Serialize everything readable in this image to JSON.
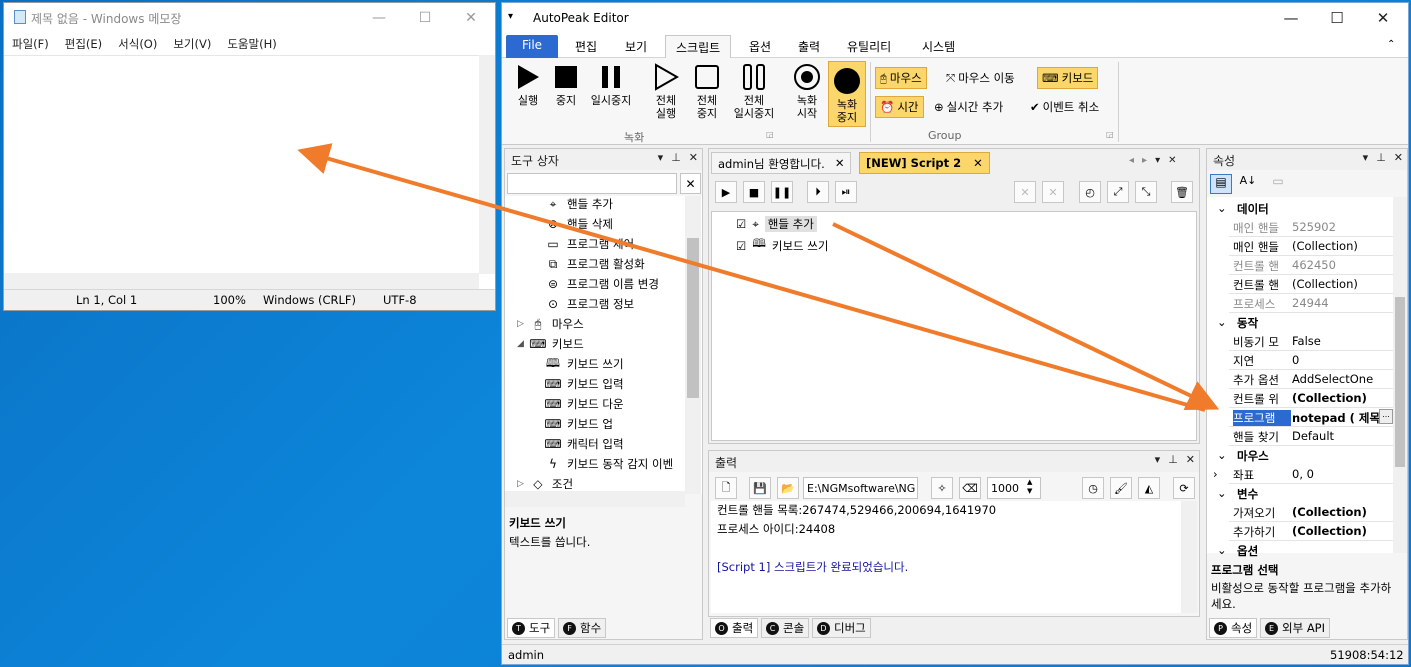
{
  "notepad": {
    "title": "제목 없음 - Windows 메모장",
    "menu": [
      "파일(F)",
      "편집(E)",
      "서식(O)",
      "보기(V)",
      "도움말(H)"
    ],
    "status": {
      "position": "Ln 1, Col 1",
      "zoom": "100%",
      "line_ending": "Windows (CRLF)",
      "encoding": "UTF-8"
    }
  },
  "app": {
    "title": "AutoPeak Editor",
    "ribbon_tabs": [
      "File",
      "편집",
      "보기",
      "스크립트",
      "옵션",
      "출력",
      "유틸리티",
      "시스템"
    ],
    "active_tab": "스크립트",
    "record_group": {
      "label": "녹화",
      "buttons": [
        {
          "label": "실행",
          "icon": "play-icon"
        },
        {
          "label": "중지",
          "icon": "stop-icon"
        },
        {
          "label": "일시중지",
          "icon": "pause-icon"
        },
        {
          "label": "전체\n실행",
          "icon": "play-outline-icon"
        },
        {
          "label": "전체\n중지",
          "icon": "stop-outline-icon"
        },
        {
          "label": "전체\n일시중지",
          "icon": "pause-outline-icon"
        },
        {
          "label": "녹화\n시작",
          "icon": "record-start-icon"
        },
        {
          "label": "녹화\n중지",
          "icon": "record-stop-icon"
        }
      ]
    },
    "group": {
      "label": "Group",
      "buttons": [
        "마우스",
        "마우스 이동",
        "키보드",
        "시간",
        "실시간 추가",
        "이벤트 취소"
      ]
    },
    "toolbox": {
      "title": "도구 상자",
      "items": [
        {
          "label": "핸들 추가",
          "indent": 2
        },
        {
          "label": "핸들 삭제",
          "indent": 2
        },
        {
          "label": "프로그램 제어",
          "indent": 2
        },
        {
          "label": "프로그램 활성화",
          "indent": 2
        },
        {
          "label": "프로그램 이름 변경",
          "indent": 2
        },
        {
          "label": "프로그램 정보",
          "indent": 2
        },
        {
          "label": "마우스",
          "indent": 1
        },
        {
          "label": "키보드",
          "indent": 1
        },
        {
          "label": "키보드 쓰기",
          "indent": 2
        },
        {
          "label": "키보드 입력",
          "indent": 2
        },
        {
          "label": "키보드 다운",
          "indent": 2
        },
        {
          "label": "키보드 업",
          "indent": 2
        },
        {
          "label": "캐릭터 입력",
          "indent": 2
        },
        {
          "label": "키보드 동작 감지 이벤",
          "indent": 2
        },
        {
          "label": "조건",
          "indent": 1
        }
      ],
      "desc_title": "키보드 쓰기",
      "desc_text": "텍스트를 씁니다.",
      "tabs": [
        "도구",
        "함수"
      ]
    },
    "script": {
      "tabs": [
        "admin님 환영합니다.",
        "[NEW] Script 2"
      ],
      "steps": [
        "핸들 추가",
        "키보드 쓰기"
      ]
    },
    "output": {
      "title": "출력",
      "path": "E:\\NGMsoftware\\NG",
      "count": "1000",
      "lines": [
        "컨트롤 핸들 목록:267474,529466,200694,1641970",
        "프로세스 아이디:24408",
        "",
        "[Script 1] 스크립트가 완료되었습니다."
      ],
      "tabs": [
        "출력",
        "콘솔",
        "디버그"
      ]
    },
    "properties": {
      "title": "속성",
      "categories": [
        {
          "name": "데이터",
          "rows": [
            {
              "k": "매인 핸들",
              "v": "525902",
              "gray": true
            },
            {
              "k": "매인 핸들",
              "v": "(Collection)",
              "gray": false
            },
            {
              "k": "컨트롤 핸",
              "v": "462450",
              "gray": true
            },
            {
              "k": "컨트롤 핸",
              "v": "(Collection)",
              "gray": false
            },
            {
              "k": "프로세스",
              "v": "24944",
              "gray": true
            }
          ]
        },
        {
          "name": "동작",
          "rows": [
            {
              "k": "비동기 모",
              "v": "False",
              "gray": false
            },
            {
              "k": "지연",
              "v": "0",
              "gray": false
            },
            {
              "k": "추가 옵션",
              "v": "AddSelectOne",
              "gray": false
            },
            {
              "k": "컨트롤 위",
              "v": "(Collection)",
              "bold": true
            },
            {
              "k": "프로그램",
              "v": "notepad ( 제목",
              "selected": true
            },
            {
              "k": "핸들 찾기",
              "v": "Default",
              "gray": false
            }
          ]
        },
        {
          "name": "마우스",
          "rows": [
            {
              "k": "좌표",
              "v": "0, 0",
              "expand": true
            }
          ]
        },
        {
          "name": "변수",
          "rows": [
            {
              "k": "가져오기",
              "v": "(Collection)",
              "bold": true
            },
            {
              "k": "추가하기",
              "v": "(Collection)",
              "bold": true
            }
          ]
        },
        {
          "name": "옵션",
          "rows": []
        }
      ],
      "desc_title": "프로그램 선택",
      "desc_text": "비활성으로 동작할 프로그램을 추가하세요.",
      "tabs": [
        "속성",
        "외부 API"
      ]
    },
    "status": {
      "user": "admin",
      "time": "51908:54:12"
    }
  }
}
